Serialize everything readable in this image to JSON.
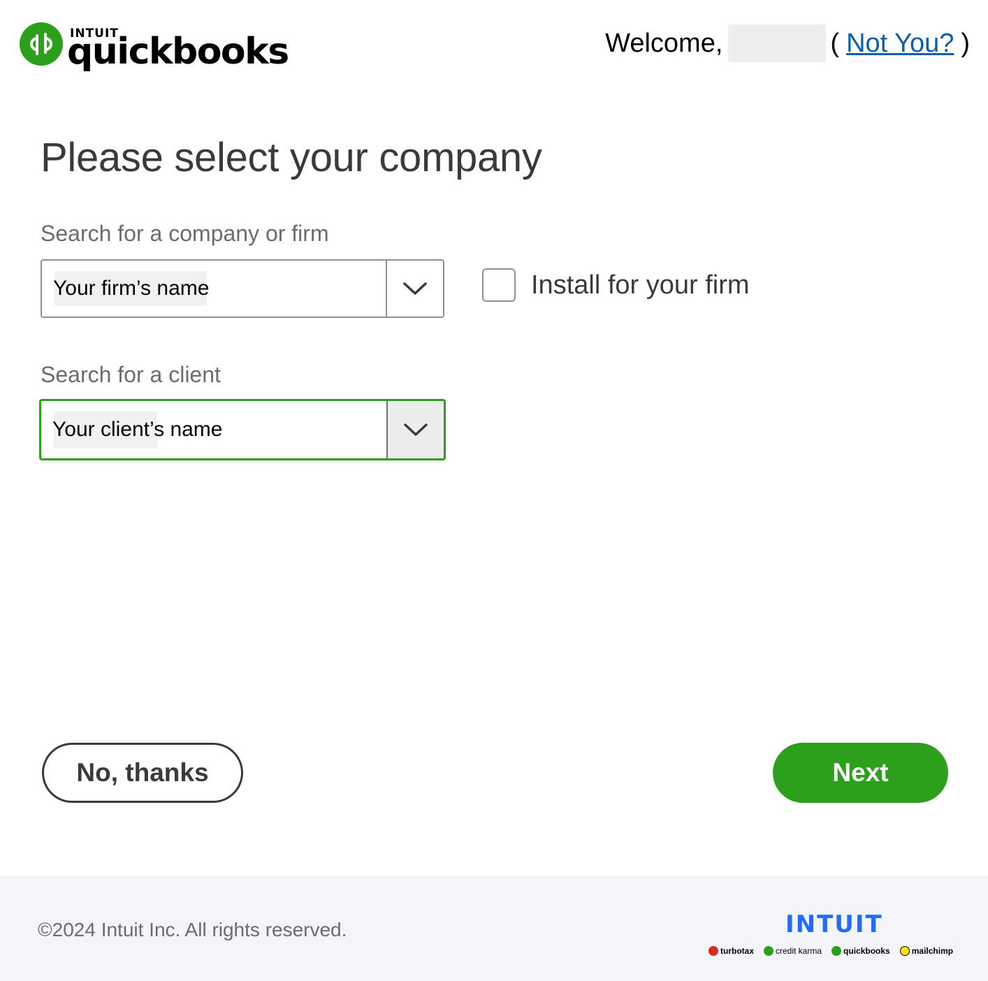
{
  "header": {
    "logo": {
      "brand_small": "INTUIT",
      "brand_word": "quickbooks",
      "icon": "quickbooks-logo-icon"
    },
    "welcome_text": "Welcome,",
    "open_paren": "(",
    "not_you_link": "Not You?",
    "close_paren": ")"
  },
  "main": {
    "title": "Please select your company",
    "company_field": {
      "label": "Search for a company or firm",
      "value": "Your firm’s name",
      "toggle_icon": "chevron-down-icon"
    },
    "install_option": {
      "label": "Install for your firm",
      "checked": false
    },
    "client_field": {
      "label": "Search for a client",
      "value": "Your client’s name",
      "toggle_icon": "chevron-down-icon",
      "focused": true
    }
  },
  "actions": {
    "secondary_label": "No, thanks",
    "primary_label": "Next"
  },
  "footer": {
    "copyright": "©2024 Intuit Inc. All rights reserved.",
    "intuit_brand": "INTUIT",
    "brands": [
      {
        "name": "turbotax",
        "color": "#d52b1e"
      },
      {
        "name": "credit karma",
        "color": "#2ca01c"
      },
      {
        "name": "quickbooks",
        "color": "#2ca01c"
      },
      {
        "name": "mailchimp",
        "color": "#ffe01b"
      }
    ]
  },
  "colors": {
    "primary_green": "#2ca01c",
    "link_blue": "#0d5fa8",
    "intuit_blue": "#236cff",
    "text_dark": "#393a3d",
    "text_muted": "#6b6c72"
  }
}
